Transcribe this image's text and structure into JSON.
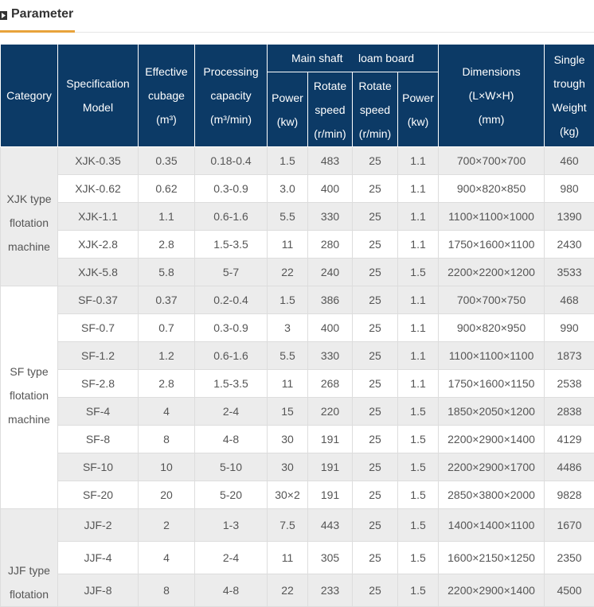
{
  "section": {
    "title": "Parameter",
    "accent_color": "#e8a33b",
    "header_bg": "#0c3a66"
  },
  "headers": {
    "category": "Category",
    "spec": [
      "Specification",
      "Model"
    ],
    "cubage": [
      "Effective",
      "cubage",
      "(m³)"
    ],
    "capacity": [
      "Processing",
      "capacity",
      "(m³/min)"
    ],
    "main_shaft": "Main shaft",
    "loam_board": "loam board",
    "power1": [
      "Power",
      "(kw)"
    ],
    "speed1": [
      "Rotate",
      "speed",
      "(r/min)"
    ],
    "speed2": [
      "Rotate",
      "speed",
      "(r/min)"
    ],
    "power2": [
      "Power",
      "(kw)"
    ],
    "dimensions": [
      "Dimensions",
      "(L×W×H)",
      "(mm)"
    ],
    "weight": [
      "Single",
      "trough",
      "Weight",
      "(kg)"
    ]
  },
  "groups": [
    {
      "category": [
        "XJK type",
        "flotation",
        "machine"
      ],
      "rows": [
        [
          "XJK-0.35",
          "0.35",
          "0.18-0.4",
          "1.5",
          "483",
          "25",
          "1.1",
          "700×700×700",
          "460"
        ],
        [
          "XJK-0.62",
          "0.62",
          "0.3-0.9",
          "3.0",
          "400",
          "25",
          "1.1",
          "900×820×850",
          "980"
        ],
        [
          "XJK-1.1",
          "1.1",
          "0.6-1.6",
          "5.5",
          "330",
          "25",
          "1.1",
          "1100×1100×1000",
          "1390"
        ],
        [
          "XJK-2.8",
          "2.8",
          "1.5-3.5",
          "11",
          "280",
          "25",
          "1.1",
          "1750×1600×1100",
          "2430"
        ],
        [
          "XJK-5.8",
          "5.8",
          "5-7",
          "22",
          "240",
          "25",
          "1.5",
          "2200×2200×1200",
          "3533"
        ]
      ]
    },
    {
      "category": [
        "SF type",
        "flotation",
        "machine"
      ],
      "rows": [
        [
          "SF-0.37",
          "0.37",
          "0.2-0.4",
          "1.5",
          "386",
          "25",
          "1.1",
          "700×700×750",
          "468"
        ],
        [
          "SF-0.7",
          "0.7",
          "0.3-0.9",
          "3",
          "400",
          "25",
          "1.1",
          "900×820×950",
          "990"
        ],
        [
          "SF-1.2",
          "1.2",
          "0.6-1.6",
          "5.5",
          "330",
          "25",
          "1.1",
          "1100×1100×1100",
          "1873"
        ],
        [
          "SF-2.8",
          "2.8",
          "1.5-3.5",
          "11",
          "268",
          "25",
          "1.1",
          "1750×1600×1150",
          "2538"
        ],
        [
          "SF-4",
          "4",
          "2-4",
          "15",
          "220",
          "25",
          "1.5",
          "1850×2050×1200",
          "2838"
        ],
        [
          "SF-8",
          "8",
          "4-8",
          "30",
          "191",
          "25",
          "1.5",
          "2200×2900×1400",
          "4129"
        ],
        [
          "SF-10",
          "10",
          "5-10",
          "30",
          "191",
          "25",
          "1.5",
          "2200×2900×1700",
          "4486"
        ],
        [
          "SF-20",
          "20",
          "5-20",
          "30×2",
          "191",
          "25",
          "1.5",
          "2850×3800×2000",
          "9828"
        ]
      ]
    },
    {
      "category": [
        "JJF type",
        "flotation"
      ],
      "rows": [
        [
          "JJF-2",
          "2",
          "1-3",
          "7.5",
          "443",
          "25",
          "1.5",
          "1400×1400×1100",
          "1670"
        ],
        [
          "JJF-4",
          "4",
          "2-4",
          "11",
          "305",
          "25",
          "1.5",
          "1600×2150×1250",
          "2350"
        ],
        [
          "JJF-8",
          "8",
          "4-8",
          "22",
          "233",
          "25",
          "1.5",
          "2200×2900×1400",
          "4500"
        ]
      ]
    }
  ]
}
